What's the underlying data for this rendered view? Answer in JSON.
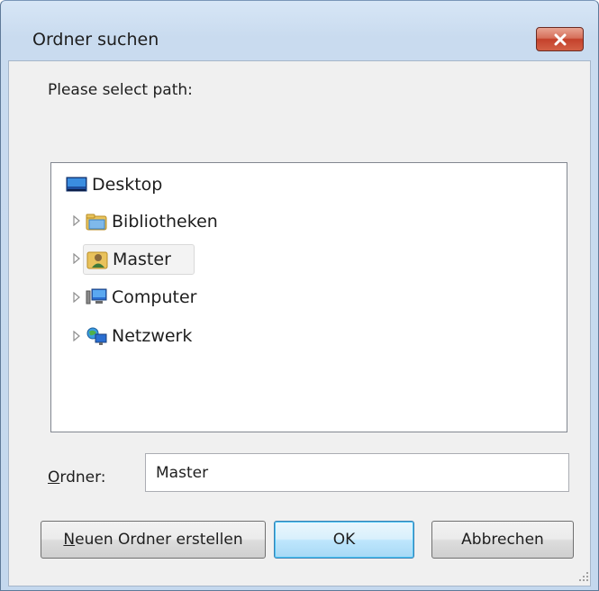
{
  "window": {
    "title": "Ordner suchen",
    "close_label": "close"
  },
  "dialog": {
    "prompt": "Please select path:"
  },
  "tree": {
    "items": [
      {
        "label": "Desktop",
        "icon": "desktop-icon",
        "expandable": false,
        "selected": false
      },
      {
        "label": "Bibliotheken",
        "icon": "libraries-folder-icon",
        "expandable": true,
        "selected": false
      },
      {
        "label": "Master",
        "icon": "user-folder-icon",
        "expandable": true,
        "selected": true
      },
      {
        "label": "Computer",
        "icon": "computer-icon",
        "expandable": true,
        "selected": false
      },
      {
        "label": "Netzwerk",
        "icon": "network-icon",
        "expandable": true,
        "selected": false
      }
    ]
  },
  "folder": {
    "label_accel": "O",
    "label_rest": "rdner:",
    "value": "Master"
  },
  "buttons": {
    "new_folder_accel": "N",
    "new_folder_rest": "euen Ordner erstellen",
    "ok": "OK",
    "cancel": "Abbrechen"
  },
  "colors": {
    "selection_bg": "#f3f3f3",
    "ok_border": "#3c7fb1",
    "close_red": "#c4412b"
  }
}
